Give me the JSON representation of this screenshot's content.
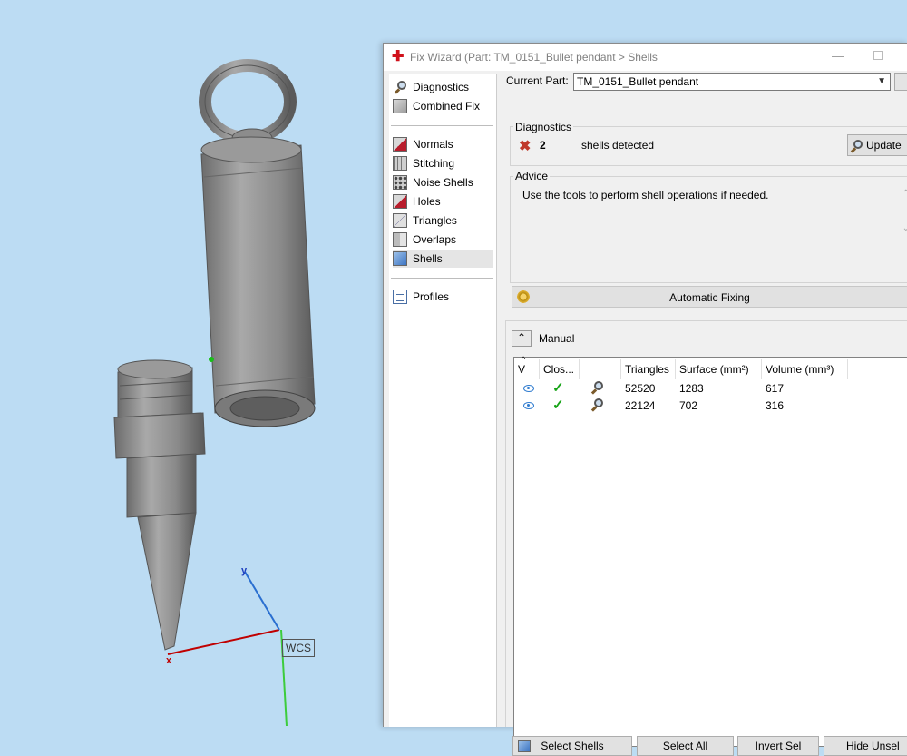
{
  "viewport": {
    "wcs_label": "WCS",
    "x_axis_label": "x",
    "y_axis_label": "y"
  },
  "window": {
    "title": "Fix Wizard (Part: TM_0151_Bullet pendant > Shells",
    "app_icon": "red-cross-icon"
  },
  "nav": {
    "items": [
      {
        "label": "Diagnostics",
        "icon": "magnifier-icon"
      },
      {
        "label": "Combined Fix",
        "icon": "combined-fix-icon"
      },
      {
        "label": "Normals",
        "icon": "normals-cube-icon"
      },
      {
        "label": "Stitching",
        "icon": "stitching-cube-icon"
      },
      {
        "label": "Noise Shells",
        "icon": "noise-shells-cube-icon"
      },
      {
        "label": "Holes",
        "icon": "holes-cube-icon"
      },
      {
        "label": "Triangles",
        "icon": "triangles-cube-icon"
      },
      {
        "label": "Overlaps",
        "icon": "overlaps-cube-icon"
      },
      {
        "label": "Shells",
        "icon": "shells-cube-icon"
      },
      {
        "label": "Profiles",
        "icon": "profiles-page-icon"
      }
    ],
    "selected": "Shells"
  },
  "current_part": {
    "label": "Current Part:",
    "value": "TM_0151_Bullet pendant"
  },
  "diagnostics": {
    "title": "Diagnostics",
    "count": "2",
    "text": "shells detected",
    "update_label": "Update"
  },
  "advice": {
    "title": "Advice",
    "text": "Use the tools to perform shell operations if needed."
  },
  "automatic_fixing_label": "Automatic Fixing",
  "manual_label": "Manual",
  "table": {
    "headers": [
      "V",
      "Clos...",
      "",
      "Triangles",
      "Surface (mm²)",
      "Volume (mm³)"
    ],
    "rows": [
      {
        "triangles": "52520",
        "surface": "1283",
        "volume": "617"
      },
      {
        "triangles": "22124",
        "surface": "702",
        "volume": "316"
      }
    ]
  },
  "buttons": {
    "select_shells": "Select Shells",
    "select_all": "Select All",
    "invert_sel": "Invert Sel",
    "hide_unsel": "Hide Unsel"
  },
  "colors": {
    "viewport_bg": "#bcdcf3",
    "model_gray": "#8a8a8a",
    "x_axis": "#c00000",
    "y_axis": "#2a6fd0",
    "z_axis": "#3ccc3c"
  }
}
